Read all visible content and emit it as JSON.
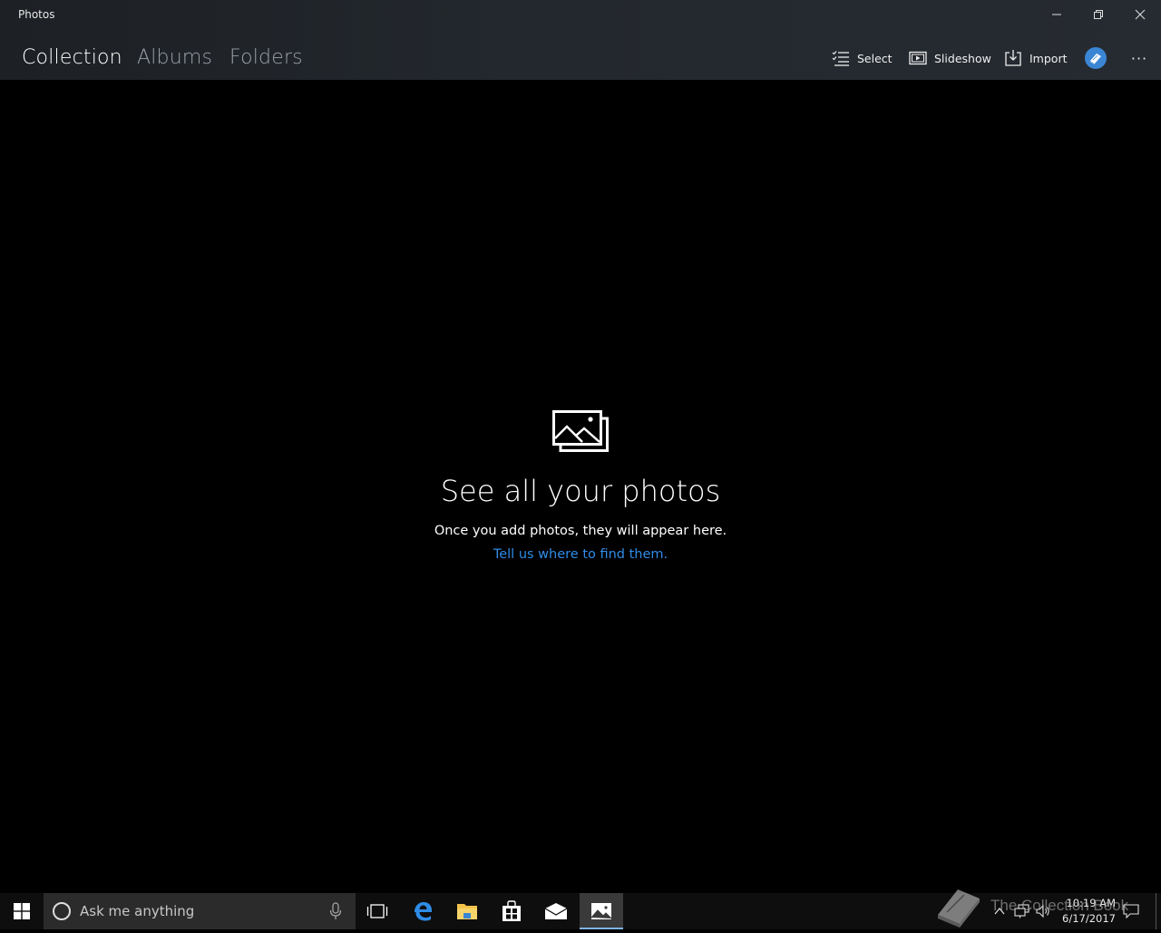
{
  "window": {
    "title": "Photos"
  },
  "nav": {
    "tabs": [
      {
        "label": "Collection",
        "active": true
      },
      {
        "label": "Albums",
        "active": false
      },
      {
        "label": "Folders",
        "active": false
      }
    ]
  },
  "toolbar": {
    "select_label": "Select",
    "slideshow_label": "Slideshow",
    "import_label": "Import",
    "more_label": "···"
  },
  "empty_state": {
    "icon": "photos-icon",
    "title": "See all your photos",
    "subtitle": "Once you add photos, they will appear here.",
    "link": "Tell us where to find them."
  },
  "taskbar": {
    "search_placeholder": "Ask me anything",
    "pinned": [
      "task-view-icon",
      "edge-icon",
      "file-explorer-icon",
      "store-icon",
      "mail-icon",
      "photos-icon"
    ],
    "clock_time": "10:19 AM",
    "clock_date": "6/17/2017"
  },
  "watermark": {
    "text": "The Collection Book"
  },
  "colors": {
    "accent_link": "#2f8ce6",
    "header_bg": "#23282e",
    "content_bg": "#000000",
    "taskbar_bg": "#0e0e0e"
  }
}
